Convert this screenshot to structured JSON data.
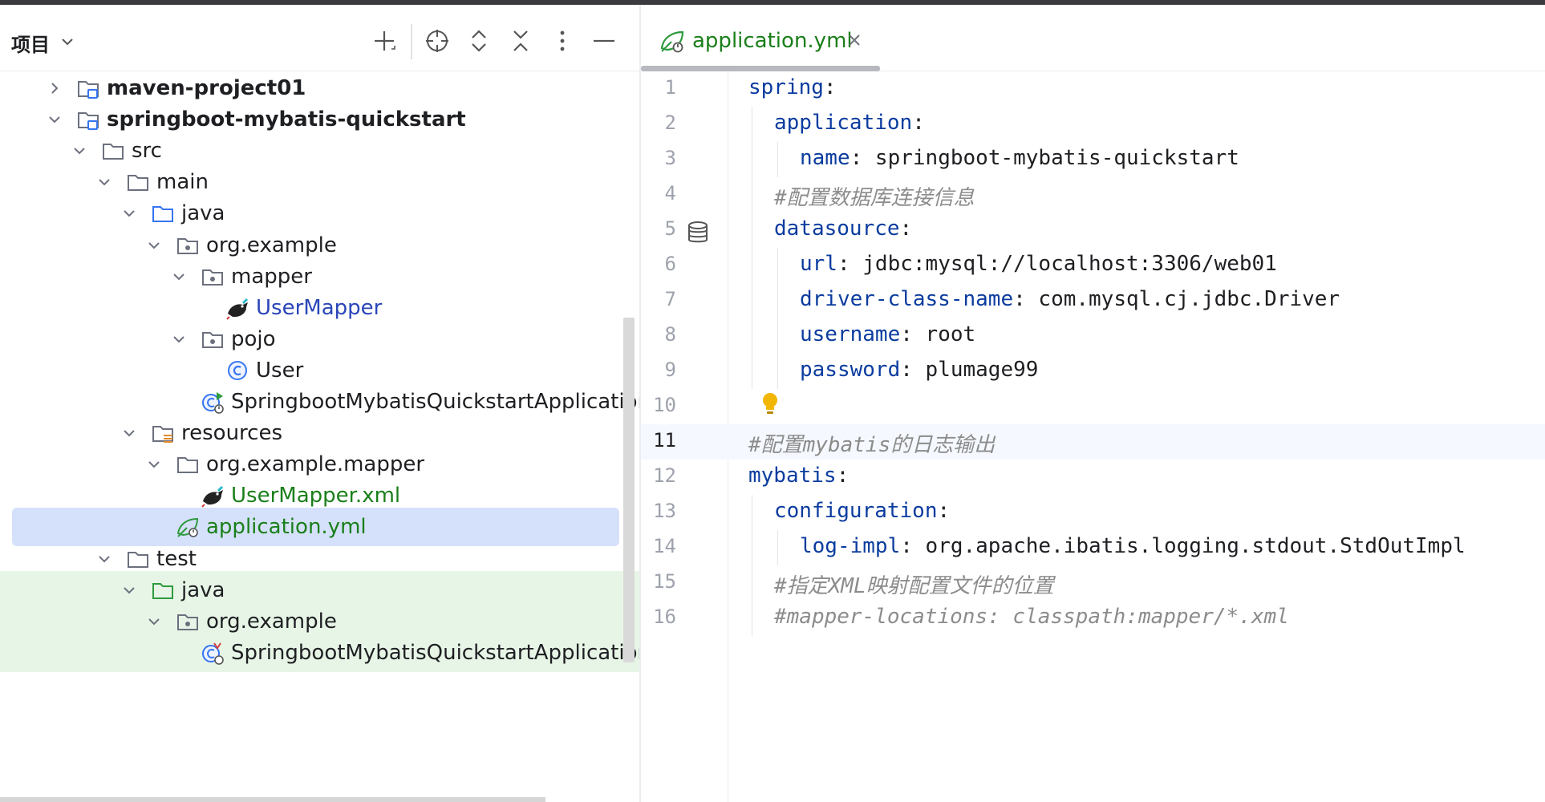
{
  "project_panel": {
    "title": "项目",
    "header_icons": [
      "add-icon",
      "locate-icon",
      "expand-all-icon",
      "collapse-all-icon",
      "more-icon",
      "minimize-icon"
    ],
    "tree": [
      {
        "label": "maven-project01",
        "level": 0,
        "expanded": false,
        "icon": "module-folder-icon",
        "style": "bold"
      },
      {
        "label": "springboot-mybatis-quickstart",
        "level": 0,
        "expanded": true,
        "icon": "module-folder-icon",
        "style": "bold"
      },
      {
        "label": "src",
        "level": 1,
        "expanded": true,
        "icon": "folder-icon"
      },
      {
        "label": "main",
        "level": 2,
        "expanded": true,
        "icon": "folder-icon"
      },
      {
        "label": "java",
        "level": 3,
        "expanded": true,
        "icon": "source-folder-icon"
      },
      {
        "label": "org.example",
        "level": 4,
        "expanded": true,
        "icon": "package-icon"
      },
      {
        "label": "mapper",
        "level": 5,
        "expanded": true,
        "icon": "package-icon"
      },
      {
        "label": "UserMapper",
        "level": 6,
        "icon": "mybatis-bird-icon",
        "style": "blue"
      },
      {
        "label": "pojo",
        "level": 5,
        "expanded": true,
        "icon": "package-icon"
      },
      {
        "label": "User",
        "level": 6,
        "icon": "class-icon"
      },
      {
        "label": "SpringbootMybatisQuickstartApplication",
        "level": 5,
        "icon": "spring-boot-class-icon"
      },
      {
        "label": "resources",
        "level": 3,
        "expanded": true,
        "icon": "resources-folder-icon"
      },
      {
        "label": "org.example.mapper",
        "level": 4,
        "expanded": true,
        "icon": "folder-icon"
      },
      {
        "label": "UserMapper.xml",
        "level": 5,
        "icon": "mybatis-bird-icon",
        "style": "green"
      },
      {
        "label": "application.yml",
        "level": 4,
        "icon": "spring-leaf-icon",
        "style": "green",
        "selected": true
      },
      {
        "label": "test",
        "level": 2,
        "expanded": true,
        "icon": "folder-icon"
      },
      {
        "label": "java",
        "level": 3,
        "expanded": true,
        "icon": "test-folder-icon",
        "highlight": "green"
      },
      {
        "label": "org.example",
        "level": 4,
        "expanded": true,
        "icon": "package-icon",
        "highlight": "green"
      },
      {
        "label": "SpringbootMybatisQuickstartApplicationT",
        "level": 5,
        "icon": "spring-boot-test-icon",
        "highlight": "green"
      }
    ]
  },
  "editor": {
    "tab": {
      "label": "application.yml",
      "icon": "spring-leaf-icon"
    },
    "current_line": 11,
    "lines": [
      {
        "n": "1",
        "indent": 0,
        "key": "spring",
        "sep": ":",
        "value": ""
      },
      {
        "n": "2",
        "indent": 1,
        "key": "application",
        "sep": ":",
        "value": ""
      },
      {
        "n": "3",
        "indent": 2,
        "key": "name",
        "sep": ":",
        "value": " springboot-mybatis-quickstart"
      },
      {
        "n": "4",
        "indent": 1,
        "comment": "#配置数据库连接信息"
      },
      {
        "n": "5",
        "indent": 1,
        "key": "datasource",
        "sep": ":",
        "value": "",
        "gutter_icon": "database-icon"
      },
      {
        "n": "6",
        "indent": 2,
        "key": "url",
        "sep": ":",
        "value": " jdbc:mysql://localhost:3306/web01"
      },
      {
        "n": "7",
        "indent": 2,
        "key": "driver-class-name",
        "sep": ":",
        "value": " com.mysql.cj.jdbc.Driver"
      },
      {
        "n": "8",
        "indent": 2,
        "key": "username",
        "sep": ":",
        "value": " root"
      },
      {
        "n": "9",
        "indent": 2,
        "key": "password",
        "sep": ":",
        "value": " plumage99"
      },
      {
        "n": "10",
        "indent": 0,
        "bulb": true
      },
      {
        "n": "11",
        "indent": 0,
        "comment": "#配置mybatis的日志输出"
      },
      {
        "n": "12",
        "indent": 0,
        "key": "mybatis",
        "sep": ":",
        "value": ""
      },
      {
        "n": "13",
        "indent": 1,
        "key": "configuration",
        "sep": ":",
        "value": ""
      },
      {
        "n": "14",
        "indent": 2,
        "key": "log-impl",
        "sep": ":",
        "value": " org.apache.ibatis.logging.stdout.StdOutImpl"
      },
      {
        "n": "15",
        "indent": 1,
        "comment": "#指定XML映射配置文件的位置"
      },
      {
        "n": "16",
        "indent": 1,
        "comment": "#mapper-locations: classpath:mapper/*.xml"
      }
    ]
  },
  "colors": {
    "key": "#0b3c9f",
    "comment": "#8c8c8c",
    "green_text": "#1a7f1a",
    "blue_text": "#2a46b8",
    "selection": "#d5e1fb",
    "test_highlight": "#e7f5e7"
  }
}
